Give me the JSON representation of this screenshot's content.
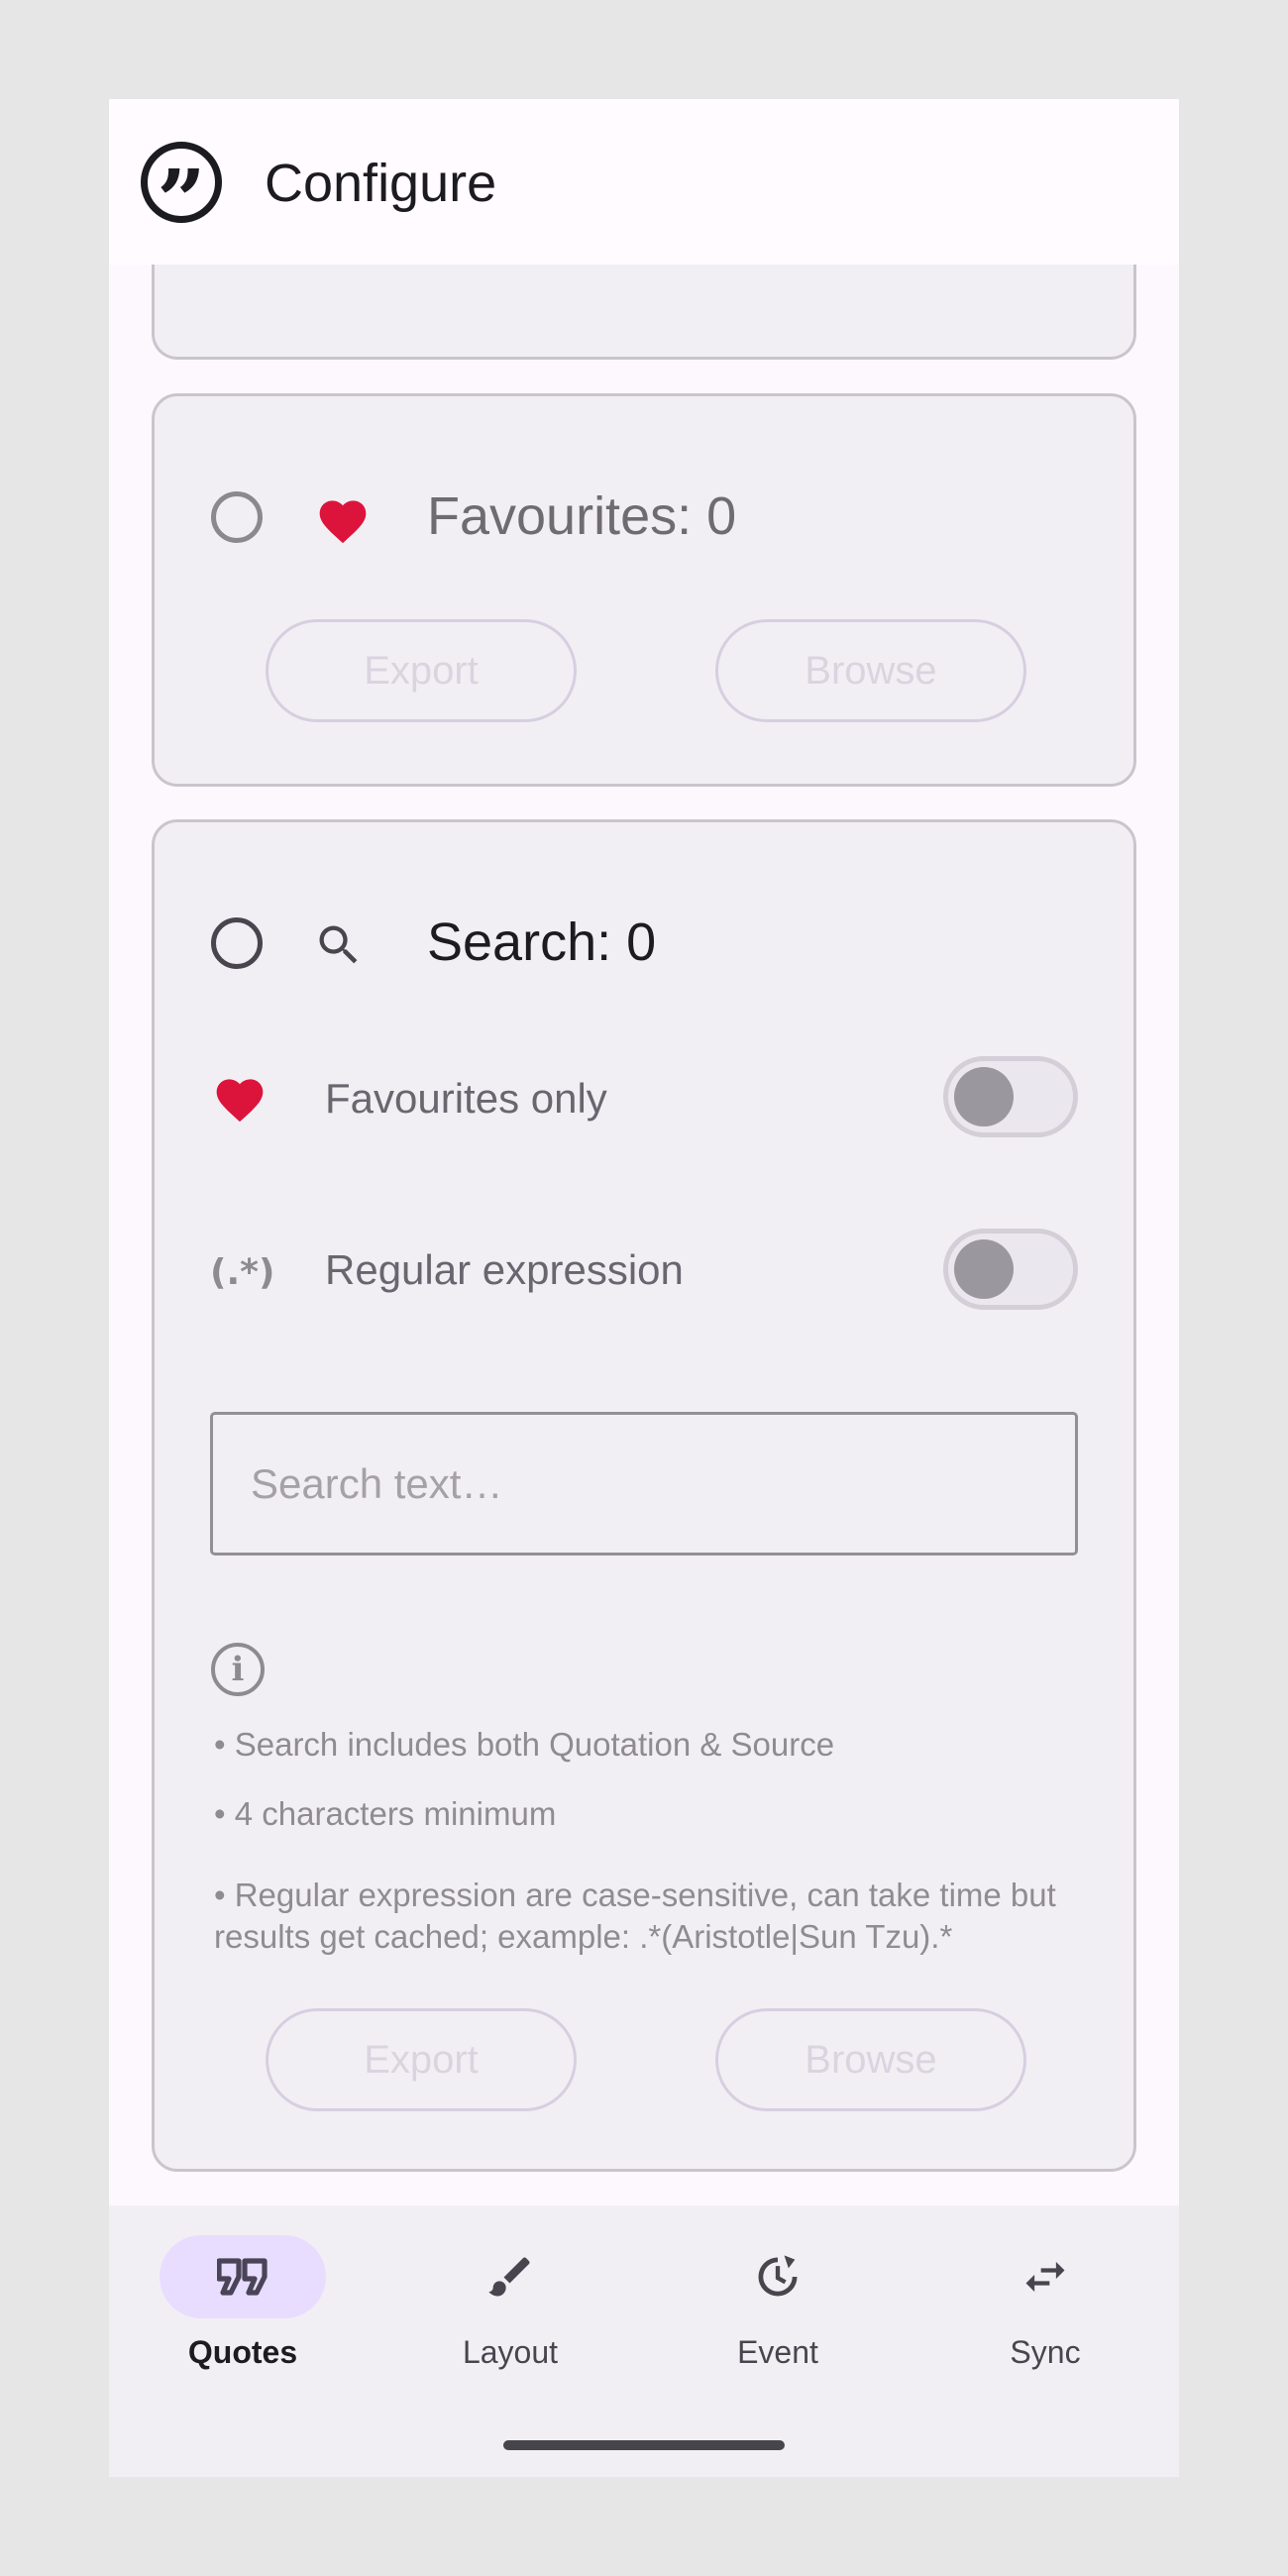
{
  "app_bar": {
    "title": "Configure",
    "logo_icon": "quote-logo-icon"
  },
  "colors": {
    "accent": "#dc143c",
    "surface": "#f2eff4",
    "nav_active": "#e8ddff"
  },
  "favourites_card": {
    "title": "Favourites: 0",
    "export_label": "Export",
    "browse_label": "Browse"
  },
  "search_card": {
    "title": "Search: 0",
    "favourites_only_label": "Favourites only",
    "regex_label": "Regular expression",
    "regex_icon": "(.*)",
    "search_placeholder": "Search text…",
    "notes": [
      "• Search includes both Quotation & Source",
      "• 4 characters minimum",
      "• Regular expression are case-sensitive, can take time but results get cached; example: .*(Aristotle|Sun Tzu).*"
    ],
    "export_label": "Export",
    "browse_label": "Browse"
  },
  "bottom_nav": {
    "items": [
      {
        "label": "Quotes",
        "icon": "quote-icon",
        "active": true
      },
      {
        "label": "Layout",
        "icon": "brush-icon",
        "active": false
      },
      {
        "label": "Event",
        "icon": "event-clock-icon",
        "active": false
      },
      {
        "label": "Sync",
        "icon": "sync-arrows-icon",
        "active": false
      }
    ]
  }
}
